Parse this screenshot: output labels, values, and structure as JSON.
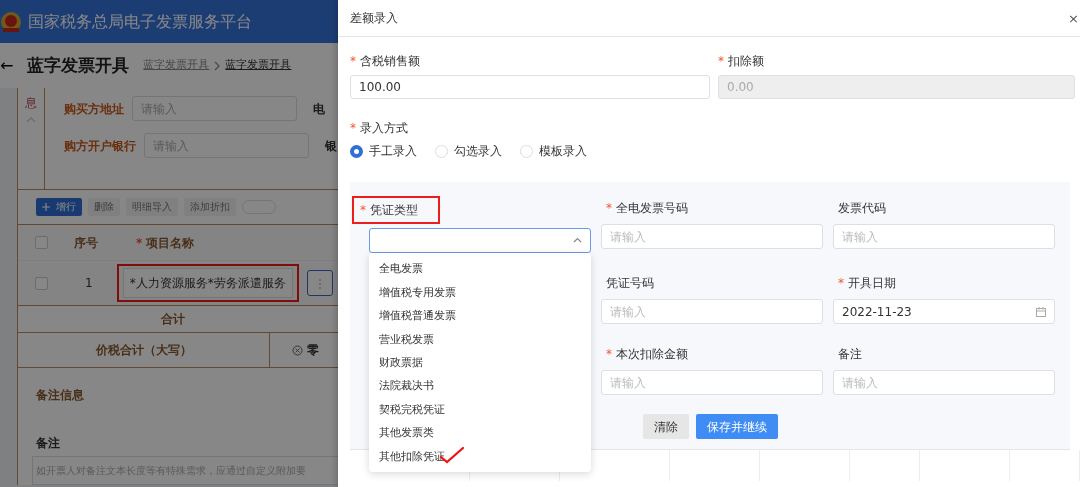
{
  "header": {
    "title": "国家税务总局电子发票服务平台"
  },
  "page": {
    "back": "←",
    "title": "蓝字发票开具",
    "breadcrumb": [
      "蓝字发票开具",
      "蓝字发票开具"
    ]
  },
  "buyer_section": {
    "side_label": "息",
    "expanded": true,
    "fields": [
      {
        "label": "购买方地址",
        "placeholder": "请输入",
        "next_label": "电"
      },
      {
        "label": "购方开户银行",
        "placeholder": "请输入",
        "next_label": "银"
      }
    ]
  },
  "toolbar": {
    "buttons": [
      {
        "label": "增行",
        "kind": "add",
        "disabled": false
      },
      {
        "label": "删除",
        "kind": "plain",
        "disabled": true
      },
      {
        "label": "明细导入",
        "kind": "plain",
        "disabled": true
      },
      {
        "label": "添加折扣",
        "kind": "plain",
        "disabled": true
      }
    ],
    "toggle_on": false
  },
  "items_table": {
    "all_checked": false,
    "columns": [
      {
        "label": "序号"
      },
      {
        "label": "项目名称",
        "required_mark": "*"
      }
    ],
    "rows": [
      {
        "index": "1",
        "name": "*人力资源服务*劳务派遣服务",
        "checked": false,
        "highlighted": true
      }
    ]
  },
  "total_label": "合计",
  "amount_words": {
    "label": "价税合计（大写）",
    "value": "零"
  },
  "remarks": {
    "section_title": "备注信息",
    "label": "备注",
    "placeholder": "如开票人对备注文本长度等有特殊需求，应通过自定义附加要"
  },
  "dialog": {
    "title": "差额录入",
    "close": "×",
    "amount_fields": [
      {
        "label": "含税销售额",
        "required_mark": "*",
        "value": "100.00",
        "disabled": false
      },
      {
        "label": "扣除额",
        "required_mark": "*",
        "value": "0.00",
        "disabled": true
      }
    ],
    "entry_mode": {
      "label": "录入方式",
      "required_mark": "*",
      "options": [
        {
          "label": "手工录入",
          "selected": true
        },
        {
          "label": "勾选录入",
          "selected": false
        },
        {
          "label": "模板录入",
          "selected": false
        }
      ]
    },
    "voucher_fields": [
      {
        "label": "凭证类型",
        "required_mark": "*",
        "kind": "select",
        "expanded": true,
        "highlighted": true
      },
      {
        "label": "全电发票号码",
        "required_mark": "*",
        "kind": "text",
        "placeholder": "请输入",
        "highlighted": false
      },
      {
        "label": "发票代码",
        "kind": "text",
        "placeholder": "请输入",
        "highlighted": false
      },
      {
        "label": "凭证号码",
        "kind": "text",
        "placeholder": "请输入",
        "highlighted": false
      },
      {
        "label": "开具日期",
        "required_mark": "*",
        "kind": "date",
        "value": "2022-11-23",
        "highlighted": false
      },
      {
        "label": "本次扣除金额",
        "required_mark": "*",
        "kind": "text",
        "placeholder": "请输入",
        "highlighted": false
      },
      {
        "label": "备注",
        "kind": "text",
        "placeholder": "请输入",
        "highlighted": false
      }
    ],
    "voucher_type_options": [
      {
        "label": "全电发票",
        "marked": false
      },
      {
        "label": "增值税专用发票",
        "marked": false
      },
      {
        "label": "增值税普通发票",
        "marked": false
      },
      {
        "label": "营业税发票",
        "marked": false
      },
      {
        "label": "财政票据",
        "marked": false
      },
      {
        "label": "法院裁决书",
        "marked": false
      },
      {
        "label": "契税完税凭证",
        "marked": false
      },
      {
        "label": "其他发票类",
        "marked": false
      },
      {
        "label": "其他扣除凭证",
        "marked": true
      }
    ],
    "buttons": [
      {
        "label": "清除",
        "kind": "secondary"
      },
      {
        "label": "保存并继续",
        "kind": "primary"
      }
    ]
  }
}
